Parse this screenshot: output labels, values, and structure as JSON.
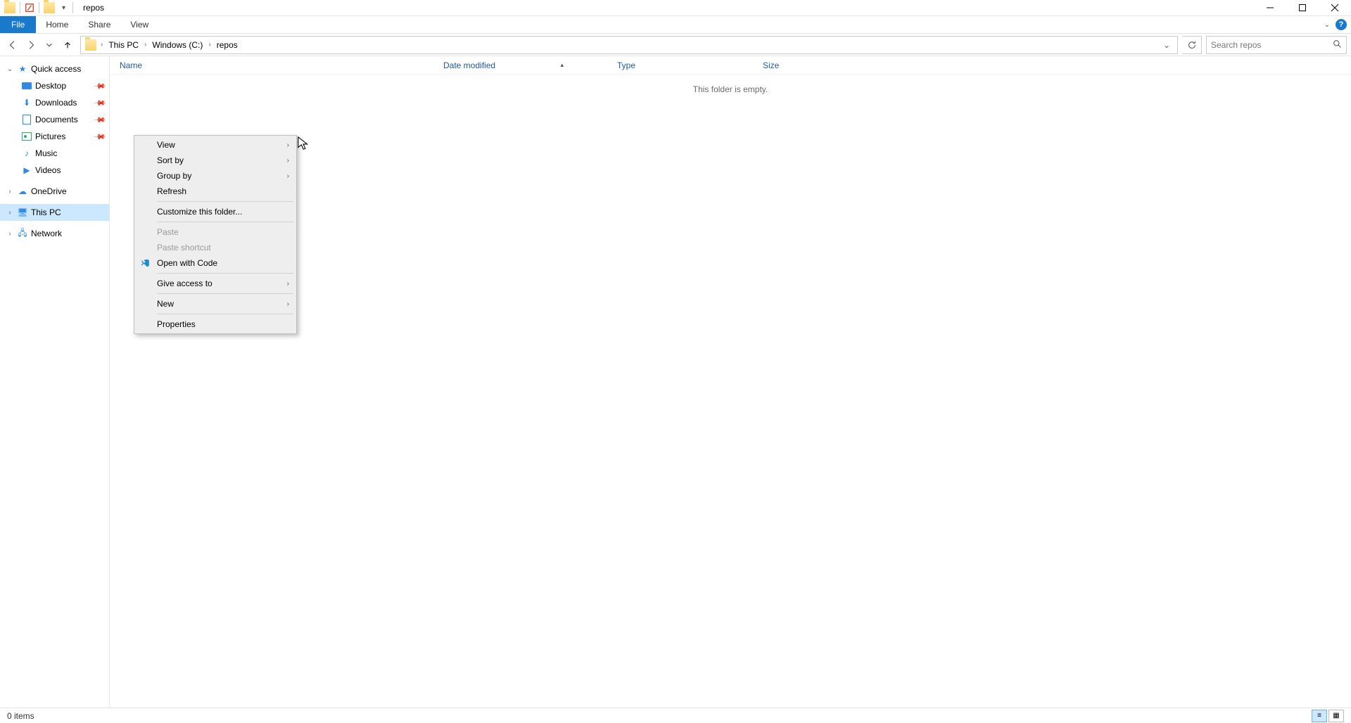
{
  "window": {
    "title": "repos"
  },
  "ribbon": {
    "file": "File",
    "tabs": [
      "Home",
      "Share",
      "View"
    ]
  },
  "nav": {
    "back_enabled": false,
    "forward_enabled": false,
    "crumbs": [
      "This PC",
      "Windows (C:)",
      "repos"
    ]
  },
  "search": {
    "placeholder": "Search repos"
  },
  "sidebar": {
    "quick_access": "Quick access",
    "items": [
      {
        "label": "Desktop",
        "pinned": true
      },
      {
        "label": "Downloads",
        "pinned": true
      },
      {
        "label": "Documents",
        "pinned": true
      },
      {
        "label": "Pictures",
        "pinned": true
      },
      {
        "label": "Music",
        "pinned": false
      },
      {
        "label": "Videos",
        "pinned": false
      }
    ],
    "onedrive": "OneDrive",
    "this_pc": "This PC",
    "network": "Network"
  },
  "columns": {
    "name": "Name",
    "date": "Date modified",
    "type": "Type",
    "size": "Size"
  },
  "empty_text": "This folder is empty.",
  "context_menu": {
    "view": "View",
    "sort_by": "Sort by",
    "group_by": "Group by",
    "refresh": "Refresh",
    "customize": "Customize this folder...",
    "paste": "Paste",
    "paste_sc": "Paste shortcut",
    "open_code": "Open with Code",
    "give_access": "Give access to",
    "new": "New",
    "properties": "Properties"
  },
  "status": {
    "items": "0 items"
  }
}
